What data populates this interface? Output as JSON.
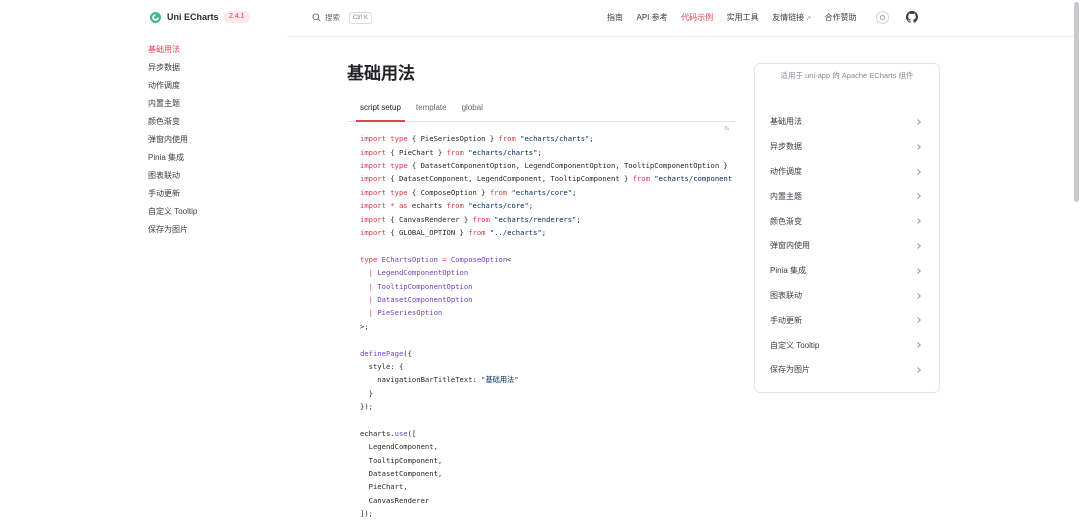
{
  "header": {
    "brand": "Uni ECharts",
    "version": "2.4.1",
    "search_label": "搜索",
    "search_shortcut": "Ctrl K",
    "nav": [
      {
        "label": "指南",
        "active": false,
        "external": false
      },
      {
        "label": "API 参考",
        "active": false,
        "external": false
      },
      {
        "label": "代码示例",
        "active": true,
        "external": false
      },
      {
        "label": "实用工具",
        "active": false,
        "external": false
      },
      {
        "label": "友情链接",
        "active": false,
        "external": true
      },
      {
        "label": "合作赞助",
        "active": false,
        "external": false
      }
    ],
    "icons": [
      "logo-icon",
      "search-icon",
      "theme-toggle-icon",
      "github-icon",
      "external-link-icon"
    ]
  },
  "sidebar": {
    "active_index": 0,
    "items": [
      "基础用法",
      "异步数据",
      "动作调度",
      "内置主题",
      "颜色渐变",
      "弹窗内使用",
      "Pinia 集成",
      "图表联动",
      "手动更新",
      "自定义 Tooltip",
      "保存为图片"
    ]
  },
  "main": {
    "title": "基础用法",
    "active_tab": 0,
    "tabs": [
      "script setup",
      "template",
      "global"
    ],
    "code_lang": "ts",
    "code": [
      [
        [
          "k",
          "import"
        ],
        [
          "p",
          " "
        ],
        [
          "k",
          "type"
        ],
        [
          "p",
          " { PieSeriesOption } "
        ],
        [
          "k",
          "from"
        ],
        [
          "p",
          " "
        ],
        [
          "s",
          "\"echarts/charts\""
        ],
        [
          "p",
          ";"
        ]
      ],
      [
        [
          "k",
          "import"
        ],
        [
          "p",
          " { PieChart } "
        ],
        [
          "k",
          "from"
        ],
        [
          "p",
          " "
        ],
        [
          "s",
          "\"echarts/charts\""
        ],
        [
          "p",
          ";"
        ]
      ],
      [
        [
          "k",
          "import"
        ],
        [
          "p",
          " "
        ],
        [
          "k",
          "type"
        ],
        [
          "p",
          " { DatasetComponentOption, LegendComponentOption, TooltipComponentOption }"
        ]
      ],
      [
        [
          "k",
          "import"
        ],
        [
          "p",
          " { DatasetComponent, LegendComponent, TooltipComponent } "
        ],
        [
          "k",
          "from"
        ],
        [
          "p",
          " "
        ],
        [
          "s",
          "\"echarts/component"
        ]
      ],
      [
        [
          "k",
          "import"
        ],
        [
          "p",
          " "
        ],
        [
          "k",
          "type"
        ],
        [
          "p",
          " { ComposeOption } "
        ],
        [
          "k",
          "from"
        ],
        [
          "p",
          " "
        ],
        [
          "s",
          "\"echarts/core\""
        ],
        [
          "p",
          ";"
        ]
      ],
      [
        [
          "k",
          "import"
        ],
        [
          "p",
          " "
        ],
        [
          "k",
          "*"
        ],
        [
          "p",
          " "
        ],
        [
          "k",
          "as"
        ],
        [
          "p",
          " echarts "
        ],
        [
          "k",
          "from"
        ],
        [
          "p",
          " "
        ],
        [
          "s",
          "\"echarts/core\""
        ],
        [
          "p",
          ";"
        ]
      ],
      [
        [
          "k",
          "import"
        ],
        [
          "p",
          " { CanvasRenderer } "
        ],
        [
          "k",
          "from"
        ],
        [
          "p",
          " "
        ],
        [
          "s",
          "\"echarts/renderers\""
        ],
        [
          "p",
          ";"
        ]
      ],
      [
        [
          "k",
          "import"
        ],
        [
          "p",
          " { GLOBAL_OPTION } "
        ],
        [
          "k",
          "from"
        ],
        [
          "p",
          " "
        ],
        [
          "s",
          "\"../echarts\""
        ],
        [
          "p",
          ";"
        ]
      ],
      [],
      [
        [
          "k",
          "type"
        ],
        [
          "p",
          " "
        ],
        [
          "t",
          "EChartsOption"
        ],
        [
          "p",
          " "
        ],
        [
          "k",
          "="
        ],
        [
          "p",
          " "
        ],
        [
          "t",
          "ComposeOption"
        ],
        [
          "p",
          "<"
        ]
      ],
      [
        [
          "p",
          "  "
        ],
        [
          "k",
          "|"
        ],
        [
          "p",
          " "
        ],
        [
          "t",
          "LegendComponentOption"
        ]
      ],
      [
        [
          "p",
          "  "
        ],
        [
          "k",
          "|"
        ],
        [
          "p",
          " "
        ],
        [
          "t",
          "TooltipComponentOption"
        ]
      ],
      [
        [
          "p",
          "  "
        ],
        [
          "k",
          "|"
        ],
        [
          "p",
          " "
        ],
        [
          "t",
          "DatasetComponentOption"
        ]
      ],
      [
        [
          "p",
          "  "
        ],
        [
          "k",
          "|"
        ],
        [
          "p",
          " "
        ],
        [
          "t",
          "PieSeriesOption"
        ]
      ],
      [
        [
          "p",
          ">;"
        ]
      ],
      [],
      [
        [
          "t",
          "definePage"
        ],
        [
          "p",
          "({"
        ]
      ],
      [
        [
          "p",
          "  style: {"
        ]
      ],
      [
        [
          "p",
          "    navigationBarTitleText: "
        ],
        [
          "s",
          "\"基础用法\""
        ]
      ],
      [
        [
          "p",
          "  }"
        ]
      ],
      [
        [
          "p",
          "});"
        ]
      ],
      [],
      [
        [
          "p",
          "echarts."
        ],
        [
          "t",
          "use"
        ],
        [
          "p",
          "(["
        ]
      ],
      [
        [
          "p",
          "  LegendComponent,"
        ]
      ],
      [
        [
          "p",
          "  TooltipComponent,"
        ]
      ],
      [
        [
          "p",
          "  DatasetComponent,"
        ]
      ],
      [
        [
          "p",
          "  PieChart,"
        ]
      ],
      [
        [
          "p",
          "  CanvasRenderer"
        ]
      ],
      [
        [
          "p",
          "]);"
        ]
      ]
    ]
  },
  "aside": {
    "tagline": "适用于 uni-app 的 Apache ECharts 组件",
    "items": [
      "基础用法",
      "异步数据",
      "动作调度",
      "内置主题",
      "颜色渐变",
      "弹窗内使用",
      "Pinia 集成",
      "图表联动",
      "手动更新",
      "自定义 Tooltip",
      "保存为图片"
    ]
  },
  "colors": {
    "accent": "#e0434f",
    "badge_bg": "#fde8eb",
    "brand_green": "#3fb984",
    "keyword": "#d73a49",
    "string": "#032f62",
    "type": "#6f42c1"
  }
}
